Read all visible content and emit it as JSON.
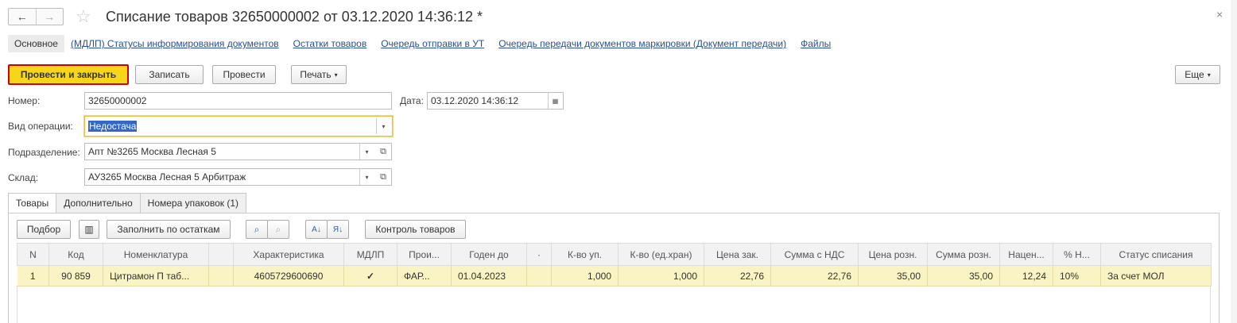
{
  "window": {
    "title": "Списание товаров 32650000002 от 03.12.2020 14:36:12 *",
    "back_icon": "←",
    "forward_icon": "→",
    "star_icon": "☆",
    "close_icon": "×"
  },
  "nav_tabs": [
    {
      "label": "Основное",
      "active": true
    },
    {
      "label": "(МДЛП) Статусы информирования документов"
    },
    {
      "label": "Остатки товаров"
    },
    {
      "label": "Очередь отправки в УТ"
    },
    {
      "label": "Очередь передачи документов маркировки (Документ передачи)"
    },
    {
      "label": "Файлы"
    }
  ],
  "toolbar": {
    "post_close": "Провести и закрыть",
    "save": "Записать",
    "post": "Провести",
    "print": "Печать",
    "more": "Еще"
  },
  "form": {
    "number_label": "Номер:",
    "number_value": "32650000002",
    "date_label": "Дата:",
    "date_value": "03.12.2020 14:36:12",
    "operation_label": "Вид операции:",
    "operation_value": "Недостача",
    "division_label": "Подразделение:",
    "division_value": "Апт №3265 Москва Лесная 5",
    "warehouse_label": "Склад:",
    "warehouse_value": "АУ3265 Москва Лесная 5 Арбитраж"
  },
  "inner_tabs": [
    {
      "label": "Товары",
      "active": true
    },
    {
      "label": "Дополнительно"
    },
    {
      "label": "Номера упаковок (1)"
    }
  ],
  "table_toolbar": {
    "pick": "Подбор",
    "fill": "Заполнить по остаткам",
    "control": "Контроль товаров"
  },
  "table": {
    "columns": [
      "N",
      "Код",
      "Номенклатура",
      "",
      "Характеристика",
      "МДЛП",
      "Прои...",
      "Годен до",
      "·",
      "К-во уп.",
      "К-во (ед.хран)",
      "Цена зак.",
      "Сумма с НДС",
      "Цена розн.",
      "Сумма розн.",
      "Нацен...",
      "% Н...",
      "Статус списания"
    ],
    "rows": [
      [
        "1",
        "90 859",
        "Цитрамон П таб...",
        "",
        "4605729600690",
        "✓",
        "ФАР...",
        "01.04.2023",
        "",
        "1,000",
        "1,000",
        "22,76",
        "22,76",
        "35,00",
        "35,00",
        "12,24",
        "10%",
        "За счет МОЛ"
      ]
    ]
  }
}
